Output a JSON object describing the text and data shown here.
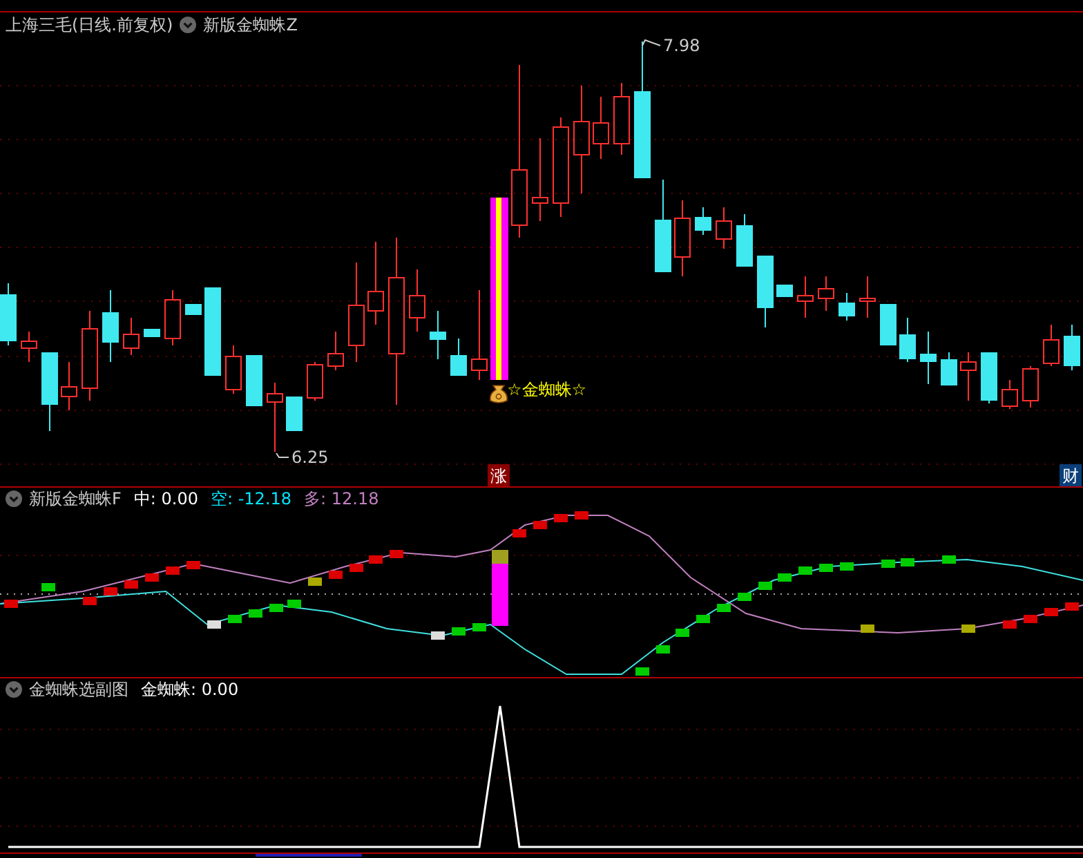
{
  "main_panel": {
    "stock": "上海三毛(日线.前复权)",
    "indicator": "新版金蜘蛛Z",
    "high_label": "7.98",
    "low_label": "6.25",
    "signal_label": "☆金蜘蛛☆",
    "badges": [
      {
        "text": "涨",
        "color": "#8b0000"
      },
      {
        "text": "财",
        "color": "#0b3f7a"
      }
    ]
  },
  "indicator_panel": {
    "name": "新版金蜘蛛F",
    "values": [
      {
        "text": "中: 0.00",
        "color": "#ffffff"
      },
      {
        "text": "空: -12.18",
        "color": "#00e5ff"
      },
      {
        "text": "多: 12.18",
        "color": "#c080c0"
      }
    ]
  },
  "sub_panel": {
    "name": "金蜘蛛选副图",
    "values": [
      {
        "text": "金蜘蛛: 0.00",
        "color": "#ffffff"
      }
    ]
  }
}
